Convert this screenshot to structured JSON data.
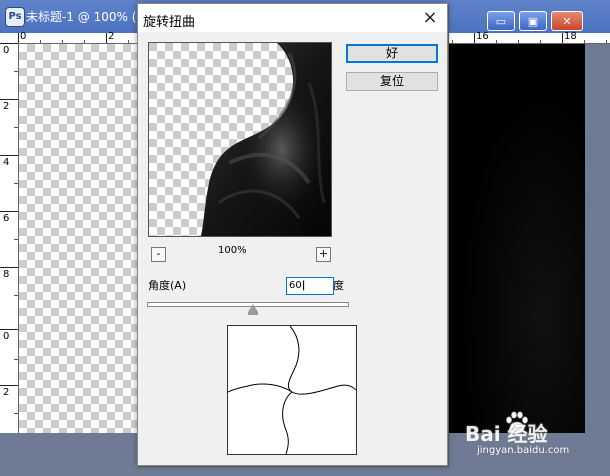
{
  "document": {
    "title": "未标题-1 @ 100% (",
    "hruler_labels": [
      "0",
      "2",
      "16",
      "18"
    ],
    "vruler_labels": [
      "0",
      "2",
      "4",
      "6",
      "8",
      "0",
      "2"
    ],
    "window_buttons": {
      "minimize": "▭",
      "maximize": "▣",
      "close": "✕"
    }
  },
  "dialog": {
    "title": "旋转扭曲",
    "close_label": "×",
    "ok_label": "好",
    "reset_label": "复位",
    "zoom_out": "-",
    "zoom_in": "+",
    "zoom_level": "100%",
    "angle_label": "角度(A)",
    "angle_value": "60",
    "angle_unit": "度"
  },
  "watermark": {
    "brand": "Bai 经验",
    "url": "jingyan.baidu.com"
  },
  "colors": {
    "titlebar": "#5f82c9",
    "dialog_bg": "#f0f0f0",
    "default_button_border": "#0078d7"
  }
}
